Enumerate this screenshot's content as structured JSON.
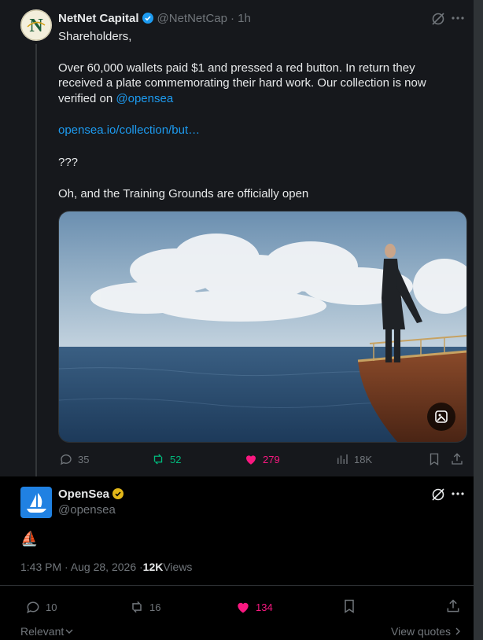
{
  "tweet": {
    "author_name": "NetNet Capital",
    "handle": "@NetNetCap",
    "time": "· 1h",
    "lines": [
      "Shareholders,",
      "Over 60,000 wallets paid $1 and pressed a red button. In return they",
      "received a plate commemorating their hard work. Our collection is now",
      "verified on ",
      "@opensea",
      "opensea.io/collection/but…",
      "???",
      "Oh, and the Training Grounds are officially open"
    ],
    "stats": {
      "replies": "35",
      "reposts": "52",
      "likes": "279",
      "views": "18K"
    }
  },
  "reply": {
    "author_name": "OpenSea",
    "handle": "@opensea",
    "body": "⛵",
    "timestamp": "1:43 PM · Aug 28, 2026 · ",
    "views_count": "12K",
    "views_label": " Views",
    "stats": {
      "replies": "10",
      "reposts": "16",
      "likes": "134"
    }
  },
  "footer": {
    "sort_label": "Relevant",
    "view_quotes": "View quotes"
  },
  "colors": {
    "like_pink": "#f91880",
    "repost_green": "#00ba7c",
    "link_blue": "#1d9bf0",
    "verified_blue": "#1d9bf0",
    "verified_gold": "#e2b719"
  }
}
